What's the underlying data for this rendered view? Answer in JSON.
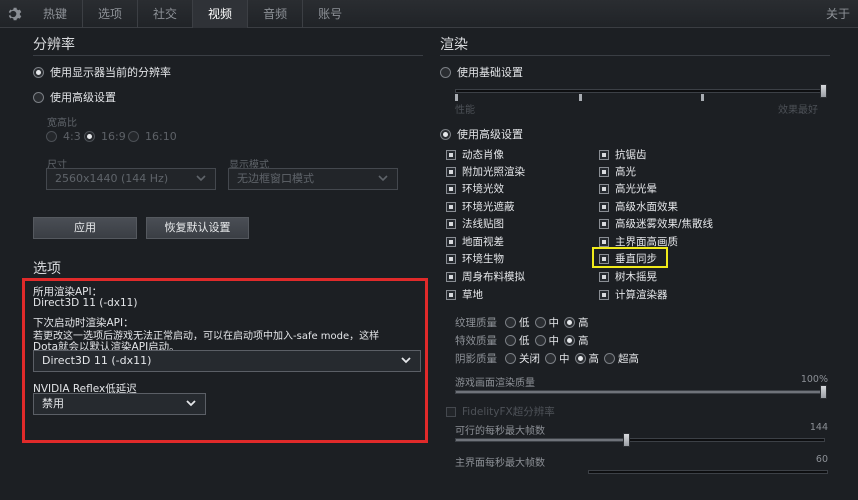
{
  "topbar": {
    "tabs": [
      "热键",
      "选项",
      "社交",
      "视频",
      "音频",
      "账号"
    ],
    "active_tab": "视频",
    "about": "关于"
  },
  "resolution": {
    "title": "分辨率",
    "use_display_res": "使用显示器当前的分辨率",
    "use_advanced": "使用高级设置",
    "aspect_label": "宽高比",
    "aspect_options": [
      "4:3",
      "16:9",
      "16:10"
    ],
    "size_label": "尺寸",
    "size_value": "2560x1440 (144 Hz)",
    "display_mode_label": "显示模式",
    "display_mode_value": "无边框窗口模式",
    "apply_button": "应用",
    "reset_button": "恢复默认设置"
  },
  "options": {
    "title": "选项",
    "api_label": "所用渲染API：",
    "api_value": "Direct3D 11 (-dx11)",
    "next_api_label": "下次启动时渲染API：",
    "note_line1": "若更改这一选项后游戏无法正常启动，可以在启动项中加入-safe mode，这样",
    "note_line2": "Dota就会以默认渲染API启动。",
    "api_select_value": "Direct3D 11 (-dx11)",
    "reflex_label": "NVIDIA Reflex低延迟",
    "reflex_value": "禁用"
  },
  "render": {
    "title": "渲染",
    "use_basic": "使用基础设置",
    "slider_min": "性能",
    "slider_max": "效果最好",
    "use_advanced": "使用高级设置",
    "checkboxes_left": [
      "动态肖像",
      "附加光照渲染",
      "环境光效",
      "环境光遮蔽",
      "法线贴图",
      "地面视差",
      "环境生物",
      "周身布料模拟",
      "草地"
    ],
    "checkboxes_right": [
      "抗锯齿",
      "高光",
      "高光光晕",
      "高级水面效果",
      "高级迷雾效果/焦散线",
      "主界面高画质",
      "垂直同步",
      "树木摇晃",
      "计算渲染器"
    ],
    "texture_quality": {
      "label": "纹理质量",
      "options": [
        "低",
        "中",
        "高"
      ],
      "selected": "高"
    },
    "effect_quality": {
      "label": "特效质量",
      "options": [
        "低",
        "中",
        "高"
      ],
      "selected": "高"
    },
    "shadow_quality": {
      "label": "阴影质量",
      "options": [
        "关闭",
        "中",
        "高",
        "超高"
      ],
      "selected": "高"
    },
    "render_quality_label": "游戏画面渲染质量",
    "render_quality_value": "100%",
    "fidelityfx_label": "FidelityFX超分辨率",
    "max_fps_label": "可行的每秒最大帧数",
    "max_fps_value": "144",
    "menu_fps_label": "主界面每秒最大帧数",
    "menu_fps_value": "60"
  }
}
